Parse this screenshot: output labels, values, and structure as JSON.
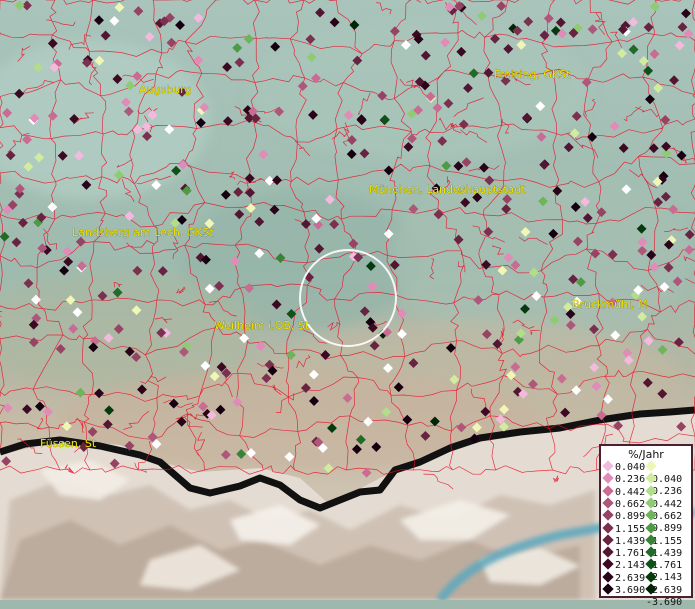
{
  "places": [
    {
      "name": "Augsburg"
    },
    {
      "name": "Freising, GKSt"
    },
    {
      "name": "München, Landeshauptstadt"
    },
    {
      "name": "Landsberg am Lech, GKSt"
    },
    {
      "name": "Weilheim i.OB, St"
    },
    {
      "name": "Bruckmühl, M"
    },
    {
      "name": "Füssen, St"
    }
  ],
  "legend": {
    "title": "%/Jahr",
    "positive": [
      {
        "label": "0.040",
        "color": "#f3b9de"
      },
      {
        "label": "0.236",
        "color": "#e08bb8"
      },
      {
        "label": "0.442",
        "color": "#c96b93"
      },
      {
        "label": "0.662",
        "color": "#ad587a"
      },
      {
        "label": "0.899",
        "color": "#964364"
      },
      {
        "label": "1.155",
        "color": "#7c3050"
      },
      {
        "label": "1.439",
        "color": "#672340"
      },
      {
        "label": "1.761",
        "color": "#521532"
      },
      {
        "label": "2.143",
        "color": "#3b0a22"
      },
      {
        "label": "2.639",
        "color": "#290418"
      },
      {
        "label": "3.690",
        "color": "#160010"
      }
    ],
    "negative": [
      {
        "label": "-0.040",
        "color": "#f0f6b6"
      },
      {
        "label": "-0.236",
        "color": "#d2ec9f"
      },
      {
        "label": "-0.442",
        "color": "#b2dd8a"
      },
      {
        "label": "-0.662",
        "color": "#8fcb72"
      },
      {
        "label": "-0.899",
        "color": "#6db45a"
      },
      {
        "label": "-1.155",
        "color": "#4f9a45"
      },
      {
        "label": "-1.439",
        "color": "#378337"
      },
      {
        "label": "-1.761",
        "color": "#216a28"
      },
      {
        "label": "-2.143",
        "color": "#10511a"
      },
      {
        "label": "-2.639",
        "color": "#053a0e"
      },
      {
        "label": "-3.690",
        "color": "#002405"
      }
    ]
  }
}
